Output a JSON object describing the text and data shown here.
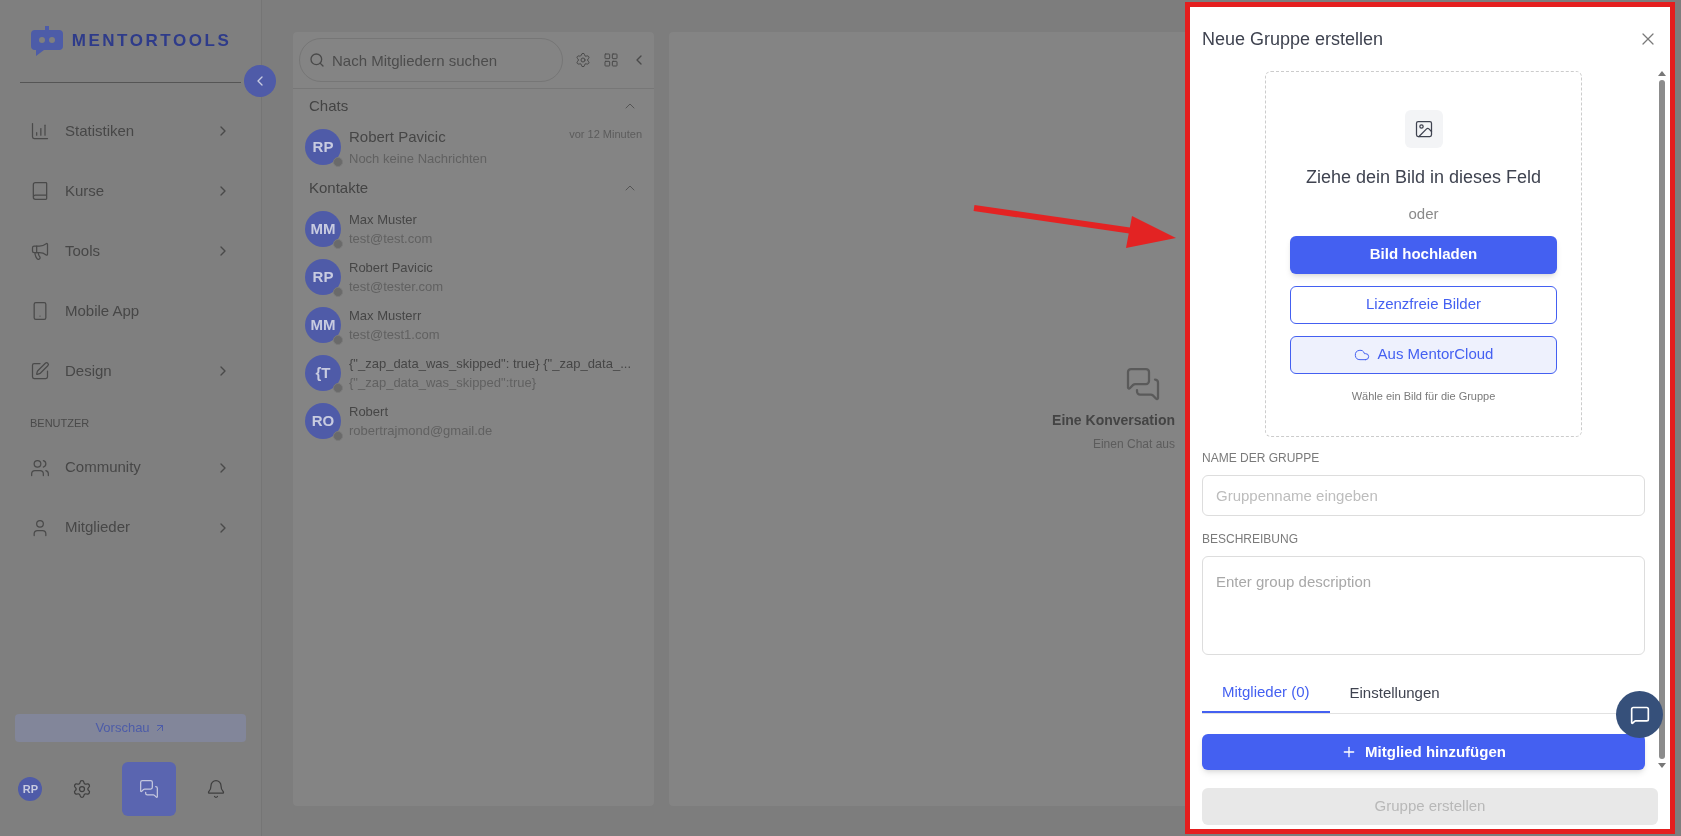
{
  "sidebar": {
    "logo": "MENTORTOOLS",
    "items": [
      {
        "label": "Statistiken",
        "expandable": true
      },
      {
        "label": "Kurse",
        "expandable": true
      },
      {
        "label": "Tools",
        "expandable": true
      },
      {
        "label": "Mobile App",
        "expandable": false
      },
      {
        "label": "Design",
        "expandable": true
      }
    ],
    "section_label": "BENUTZER",
    "section_items": [
      {
        "label": "Community",
        "expandable": true
      },
      {
        "label": "Mitglieder",
        "expandable": true
      }
    ],
    "preview_button": "Vorschau",
    "bottom_bar": [
      {
        "kind": "avatar",
        "text": "RP"
      },
      {
        "kind": "settings",
        "selected": false
      },
      {
        "kind": "chat",
        "selected": true
      },
      {
        "kind": "bell",
        "selected": false
      }
    ]
  },
  "chat_list": {
    "search": {
      "placeholder": "Nach Mitgliedern suchen"
    },
    "sections": [
      {
        "title": "Chats",
        "expanded": true,
        "items": [
          {
            "initials": "RP",
            "name": "Robert Pavicic",
            "subtitle": "Noch keine Nachrichten",
            "time": "vor 12 Minuten"
          }
        ]
      },
      {
        "title": "Kontakte",
        "expanded": true,
        "items": [
          {
            "initials": "MM",
            "name": "Max Muster",
            "subtitle": "test@test.com"
          },
          {
            "initials": "RP",
            "name": "Robert Pavicic",
            "subtitle": "test@tester.com"
          },
          {
            "initials": "MM",
            "name": "Max Musterr",
            "subtitle": "test@test1.com"
          },
          {
            "initials": "{T",
            "name": "{\"_zap_data_was_skipped\": true} {\"_zap_data_...",
            "subtitle": "{\"_zap_data_was_skipped\":true}"
          },
          {
            "initials": "RO",
            "name": "Robert",
            "subtitle": "robertrajmond@gmail.de"
          }
        ]
      }
    ]
  },
  "conversation": {
    "empty_title": "Eine Konversation",
    "empty_subtitle": "Einen Chat aus"
  },
  "drawer": {
    "title": "Neue Gruppe erstellen",
    "dropzone": {
      "headline": "Ziehe dein Bild in dieses Feld",
      "separator": "oder",
      "buttons": [
        {
          "kind": "primary",
          "label": "Bild hochladen"
        },
        {
          "kind": "outline",
          "label": "Lizenzfreie Bilder"
        },
        {
          "kind": "cloud",
          "label": "Aus MentorCloud"
        }
      ],
      "hint": "Wähle ein Bild für die Gruppe"
    },
    "name_field": {
      "label": "NAME DER GRUPPE",
      "placeholder": "Gruppenname eingeben"
    },
    "description_field": {
      "label": "BESCHREIBUNG",
      "placeholder": "Enter group description"
    },
    "tabs": [
      {
        "label": "Mitglieder (0)",
        "selected": true
      },
      {
        "label": "Einstellungen",
        "selected": false
      }
    ],
    "add_button": "Mitglied hinzufügen",
    "submit_button": {
      "label": "Gruppe erstellen",
      "disabled": true
    }
  }
}
